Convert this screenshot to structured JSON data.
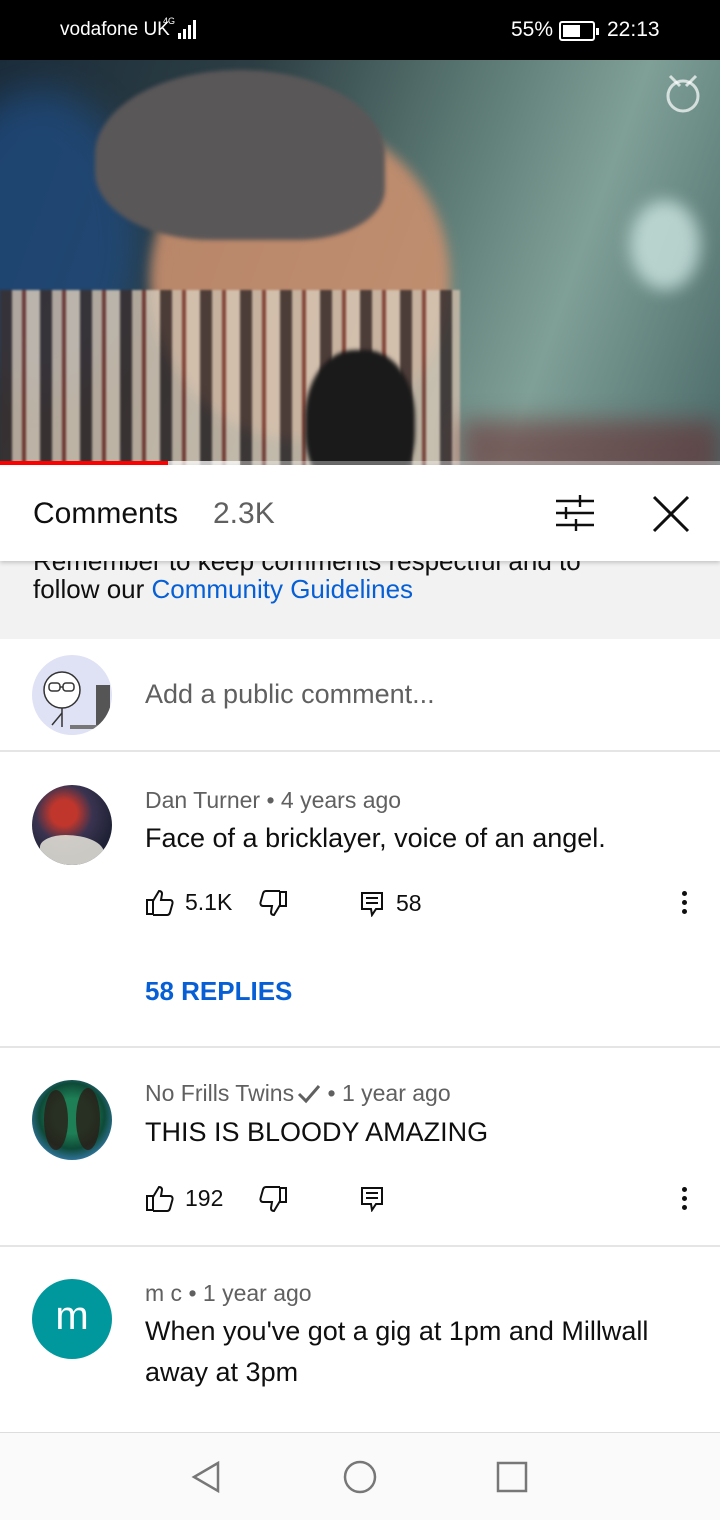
{
  "status_bar": {
    "carrier": "vodafone UK",
    "network": "4G",
    "battery": "55%",
    "time": "22:13"
  },
  "video": {
    "progress": 0.233,
    "buffered": 0.333,
    "progress_color": "#ff0000"
  },
  "comments_panel": {
    "title": "Comments",
    "count": "2.3K",
    "sort_icon": "sort-filter-icon",
    "close_icon": "close-icon"
  },
  "guidelines": {
    "clipped_line": "Remember to keep comments respectful and to",
    "prefix": "follow our ",
    "link_text": "Community Guidelines"
  },
  "add_comment": {
    "placeholder": "Add a public comment..."
  },
  "comments": [
    {
      "author": "Dan Turner",
      "time": "4 years ago",
      "text": "Face of a bricklayer, voice of an angel.",
      "likes": "5.1K",
      "reply_count": "58",
      "replies_label": "58 REPLIES"
    },
    {
      "author": "No Frills Twins",
      "verified": true,
      "time": "1 year ago",
      "text": "THIS IS BLOODY AMAZING",
      "likes": "192",
      "reply_count": ""
    },
    {
      "author": "m c",
      "avatar_letter": "m",
      "avatar_color": "#00979d",
      "time": "1 year ago",
      "text": "When you've got a gig at 1pm and Millwall away at 3pm"
    }
  ],
  "colors": {
    "link": "#065fd4",
    "secondary_text": "#606060"
  },
  "separator": "•"
}
